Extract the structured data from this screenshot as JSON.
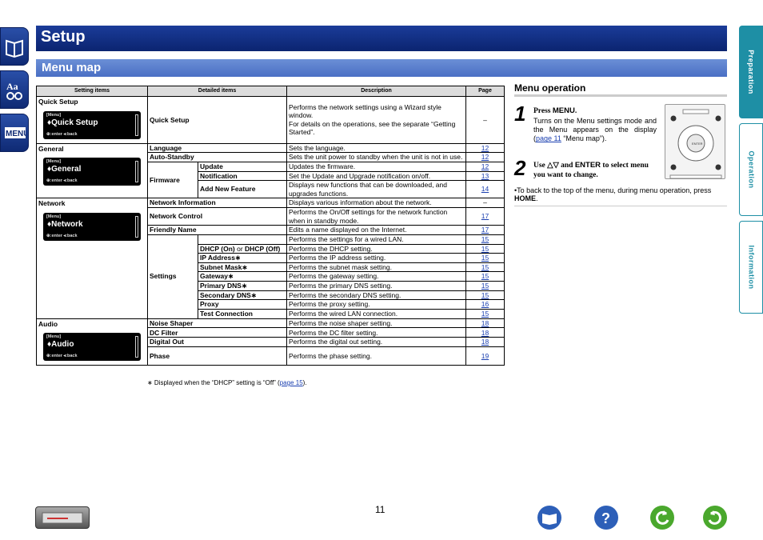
{
  "left_nav": {
    "items": [
      "contents-book-icon",
      "aa-icon",
      "menu-icon"
    ],
    "menu_label": "MENU"
  },
  "header": {
    "title": "Setup",
    "subtitle": "Menu map"
  },
  "right_tabs": [
    "Preparation",
    "Operation",
    "Information"
  ],
  "table": {
    "headers": [
      "Setting items",
      "Detailed items",
      "Description",
      "Page"
    ],
    "quick_setup": {
      "title": "Quick Setup",
      "screen": {
        "top": "[Menu]",
        "big": "♦Quick Setup",
        "bottom": "⊕:enter   ◂:back"
      },
      "detail": "Quick Setup",
      "desc": "Performs the network settings using a Wizard style window.\nFor details on the operations, see the separate “Getting Started”.",
      "page": "–"
    },
    "general": {
      "title": "General",
      "screen": {
        "top": "[Menu]",
        "big": "♦General",
        "bottom": "⊕:enter   ◂:back"
      },
      "rows": [
        {
          "d1": "Language",
          "desc": "Sets the language.",
          "page": "12"
        },
        {
          "d1": "Auto-Standby",
          "desc": "Sets the unit power to standby when the unit is not in use.",
          "page": "12"
        },
        {
          "d1": "Firmware",
          "d2": "Update",
          "desc": "Updates the firmware.",
          "page": "12"
        },
        {
          "d2": "Notification",
          "desc": "Set the Update and Upgrade notification on/off.",
          "page": "13"
        },
        {
          "d2": "Add New Feature",
          "desc": "Displays new functions that can be downloaded, and upgrades functions.",
          "page": "14"
        }
      ]
    },
    "network": {
      "title": "Network",
      "screen": {
        "top": "[Menu]",
        "big": "♦Network",
        "bottom": "⊕:enter   ◂:back"
      },
      "rows": [
        {
          "d1": "Network Information",
          "desc": "Displays various information about the network.",
          "page": "–"
        },
        {
          "d1": "Network Control",
          "desc": "Performs the On/Off settings for the network function when in standby mode.",
          "page": "17"
        },
        {
          "d1": "Friendly Name",
          "desc": "Edits a name displayed on the Internet.",
          "page": "17"
        },
        {
          "d1": "Settings",
          "desc": "Performs the settings for a wired LAN.",
          "page": "15"
        },
        {
          "d2a": "DHCP (On)",
          "d2or": " or ",
          "d2b": "DHCP (Off)",
          "desc": "Performs the DHCP setting.",
          "page": "15"
        },
        {
          "d2": "IP Address∗",
          "desc": "Performs the IP address setting.",
          "page": "15"
        },
        {
          "d2": "Subnet Mask∗",
          "desc": "Performs the subnet mask setting.",
          "page": "15"
        },
        {
          "d2": "Gateway∗",
          "desc": "Performs the gateway setting.",
          "page": "15"
        },
        {
          "d2": "Primary DNS∗",
          "desc": "Performs the primary DNS setting.",
          "page": "15"
        },
        {
          "d2": "Secondary DNS∗",
          "desc": "Performs the secondary DNS setting.",
          "page": "15"
        },
        {
          "d2": "Proxy",
          "desc": "Performs the proxy setting.",
          "page": "16"
        },
        {
          "d2": "Test Connection",
          "desc": "Performs the wired LAN connection.",
          "page": "15"
        }
      ]
    },
    "audio": {
      "title": "Audio",
      "screen": {
        "top": "[Menu]",
        "big": "♦Audio",
        "bottom": "⊕:enter   ◂:back"
      },
      "rows": [
        {
          "d1": "Noise Shaper",
          "desc": "Performs the noise shaper setting.",
          "page": "18"
        },
        {
          "d1": "DC Filter",
          "desc": "Performs the DC filter setting.",
          "page": "18"
        },
        {
          "d1": "Digital Out",
          "desc": "Performs the digital out setting.",
          "page": "18"
        },
        {
          "d1": "Phase",
          "desc": "Performs the phase setting.",
          "page": "19"
        }
      ]
    }
  },
  "footnote": {
    "pre": "∗ Displayed when the “DHCP” setting is “Off” (",
    "link": "page 15",
    "post": ")."
  },
  "menu_operation": {
    "title": "Menu operation",
    "step1": {
      "num": "1",
      "press": "Press ",
      "key": "MENU",
      "dot": ".",
      "text": "Turns on the Menu settings mode and the Menu appears on the display (",
      "link": "page 11",
      "text2": " “Menu map”)."
    },
    "step2": {
      "num": "2",
      "pre": "Use △▽ and ",
      "key": "ENTER",
      "post": " to select menu you want to change."
    },
    "note_pre": "•To back to the top of the menu, during menu operation, press ",
    "note_key": "HOME",
    "note_post": "."
  },
  "page_number": "11",
  "bottom_nav": [
    "book-icon",
    "help-icon",
    "back-icon",
    "forward-icon"
  ]
}
